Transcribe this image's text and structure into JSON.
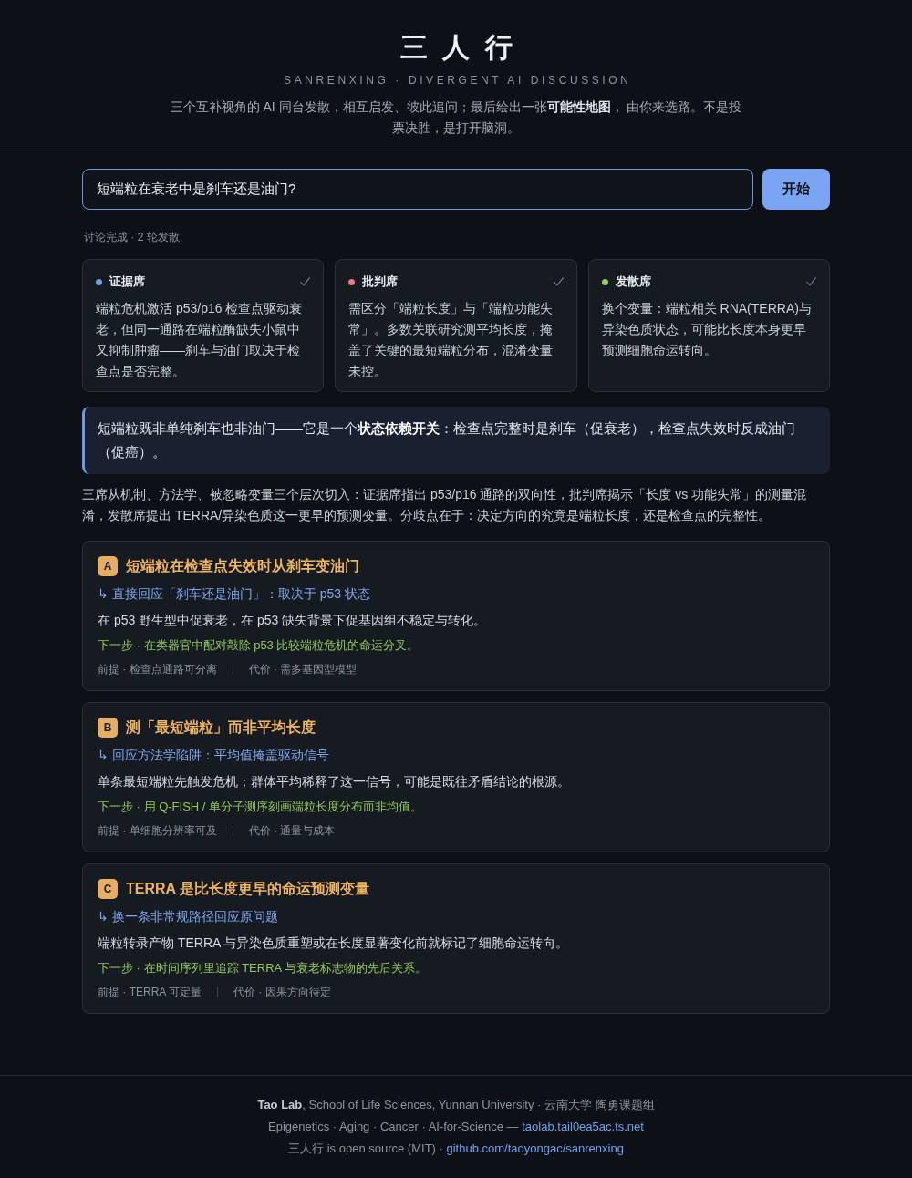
{
  "header": {
    "title": "三人行",
    "subtitle": "SANRENXING · DIVERGENT AI DISCUSSION",
    "tagline": "三个互补视角的 AI 同台发散，相互启发、彼此追问；最后绘出一张**可能性地图**， 由你来选路。不是投票决胜，是打开脑洞。"
  },
  "query": {
    "value": "短端粒在衰老中是刹车还是油门?",
    "button": "开始"
  },
  "status": "讨论完成 · 2 轮发散",
  "seats": [
    {
      "name": "证据席",
      "color": "#6e9ef0",
      "done": true,
      "text": "端粒危机激活 p53/p16 检查点驱动衰老，但同一通路在端粒酶缺失小鼠中又抑制肿瘤——刹车与油门取决于检查点是否完整。"
    },
    {
      "name": "批判席",
      "color": "#f07480",
      "done": true,
      "text": "需区分「端粒长度」与「端粒功能失常」。多数关联研究测平均长度，掩盖了关键的最短端粒分布，混淆变量未控。"
    },
    {
      "name": "发散席",
      "color": "#9ccc5a",
      "done": true,
      "text": "换个变量：端粒相关 RNA(TERRA)与异染色质状态，可能比长度本身更早预测细胞命运转向。"
    }
  ],
  "verdict": "短端粒既非单纯刹车也非油门——它是一个**状态依赖开关**：检查点完整时是刹车（促衰老），检查点失效时反成油门（促癌）。",
  "summary": "三席从机制、方法学、被忽略变量三个层次切入：证据席指出 p53/p16 通路的双向性，批判席揭示「长度 vs 功能失常」的测量混淆，发散席提出 TERRA/异染色质这一更早的预测变量。分歧点在于：决定方向的究竟是端粒长度，还是检查点的完整性。",
  "options": [
    {
      "letter": "A",
      "title": "短端粒在检查点失效时从刹车变油门",
      "response": "↳ 直接回应「刹车还是油门」：取决于 p53 状态",
      "claim": "在 p53 野生型中促衰老，在 p53 缺失背景下促基因组不稳定与转化。",
      "next": "下一步 · 在类器官中配对敲除 p53 比较端粒危机的命运分叉。",
      "premise": "前提 · 检查点通路可分离",
      "cost": "代价 · 需多基因型模型"
    },
    {
      "letter": "B",
      "title": "测「最短端粒」而非平均长度",
      "response": "↳ 回应方法学陷阱：平均值掩盖驱动信号",
      "claim": "单条最短端粒先触发危机；群体平均稀释了这一信号，可能是既往矛盾结论的根源。",
      "next": "下一步 · 用 Q-FISH / 单分子测序刻画端粒长度分布而非均值。",
      "premise": "前提 · 单细胞分辨率可及",
      "cost": "代价 · 通量与成本"
    },
    {
      "letter": "C",
      "title": "TERRA 是比长度更早的命运预测变量",
      "response": "↳ 换一条非常规路径回应原问题",
      "claim": "端粒转录产物 TERRA 与异染色质重塑或在长度显著变化前就标记了细胞命运转向。",
      "next": "下一步 · 在时间序列里追踪 TERRA 与衰老标志物的先后关系。",
      "premise": "前提 · TERRA 可定量",
      "cost": "代价 · 因果方向待定"
    }
  ],
  "footer": {
    "credit": "**Tao Lab**, School of Life Sciences, Yunnan University · 云南大学 陶勇课题组",
    "topics": "Epigenetics · Aging · Cancer · AI-for-Science —",
    "site_link": "taolab.tail0ea5ac.ts.net",
    "license": "三人行 is open source (MIT) ·",
    "repo_link": "github.com/taoyongac/sanrenxing"
  }
}
